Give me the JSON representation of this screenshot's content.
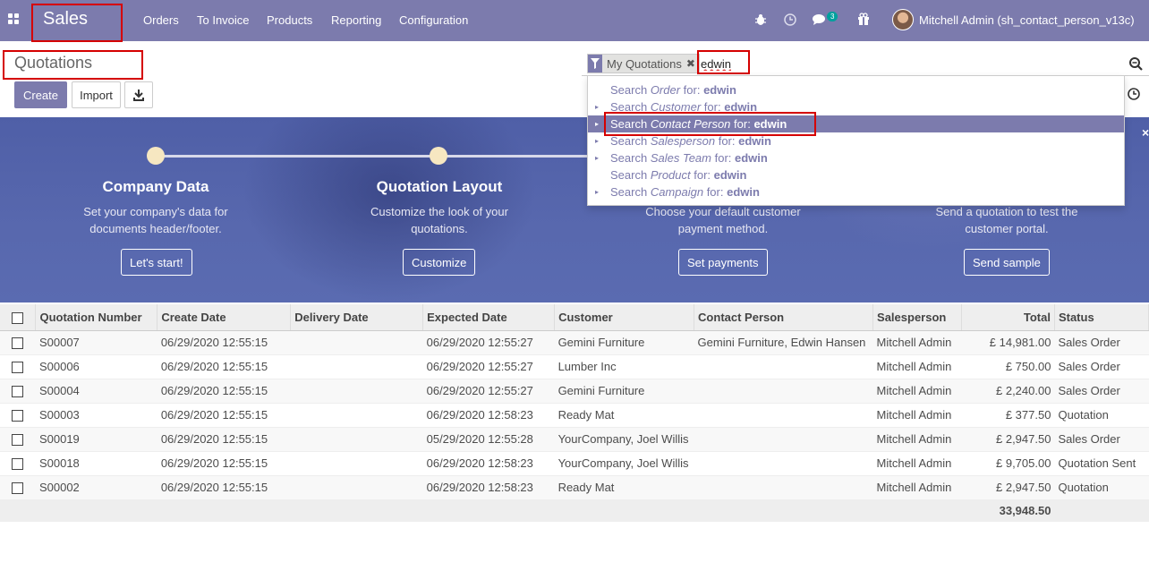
{
  "navbar": {
    "brand": "Sales",
    "menu": [
      "Orders",
      "To Invoice",
      "Products",
      "Reporting",
      "Configuration"
    ],
    "chat_count": "3",
    "user": "Mitchell Admin (sh_contact_person_v13c)"
  },
  "control": {
    "title": "Quotations",
    "create_label": "Create",
    "import_label": "Import"
  },
  "search": {
    "facet_label": "My Quotations",
    "query": "edwin",
    "suggestions": [
      {
        "prefix": "Search ",
        "field": "Order",
        "mid": " for: ",
        "term": "edwin",
        "expandable": false
      },
      {
        "prefix": "Search ",
        "field": "Customer",
        "mid": " for: ",
        "term": "edwin",
        "expandable": true
      },
      {
        "prefix": "Search ",
        "field": "Contact Person",
        "mid": " for: ",
        "term": "edwin",
        "expandable": true
      },
      {
        "prefix": "Search ",
        "field": "Salesperson",
        "mid": " for: ",
        "term": "edwin",
        "expandable": true
      },
      {
        "prefix": "Search ",
        "field": "Sales Team",
        "mid": " for: ",
        "term": "edwin",
        "expandable": true
      },
      {
        "prefix": "Search ",
        "field": "Product",
        "mid": " for: ",
        "term": "edwin",
        "expandable": false
      },
      {
        "prefix": "Search ",
        "field": "Campaign",
        "mid": " for: ",
        "term": "edwin",
        "expandable": true
      }
    ]
  },
  "onboarding": {
    "steps": [
      {
        "title": "Company Data",
        "desc1": "Set your company's data for",
        "desc2": "documents header/footer.",
        "button": "Let's start!"
      },
      {
        "title": "Quotation Layout",
        "desc1": "Customize the look of your",
        "desc2": "quotations.",
        "button": "Customize"
      },
      {
        "title": "",
        "desc1": "Choose your default customer",
        "desc2": "payment method.",
        "button": "Set payments"
      },
      {
        "title": "",
        "desc1": "Send a quotation to test the",
        "desc2": "customer portal.",
        "button": "Send sample"
      }
    ]
  },
  "table": {
    "headers": [
      "Quotation Number",
      "Create Date",
      "Delivery Date",
      "Expected Date",
      "Customer",
      "Contact Person",
      "Salesperson",
      "Total",
      "Status"
    ],
    "rows": [
      [
        "S00007",
        "06/29/2020 12:55:15",
        "",
        "06/29/2020 12:55:27",
        "Gemini Furniture",
        "Gemini Furniture, Edwin Hansen",
        "Mitchell Admin",
        "£ 14,981.00",
        "Sales Order"
      ],
      [
        "S00006",
        "06/29/2020 12:55:15",
        "",
        "06/29/2020 12:55:27",
        "Lumber Inc",
        "",
        "Mitchell Admin",
        "£ 750.00",
        "Sales Order"
      ],
      [
        "S00004",
        "06/29/2020 12:55:15",
        "",
        "06/29/2020 12:55:27",
        "Gemini Furniture",
        "",
        "Mitchell Admin",
        "£ 2,240.00",
        "Sales Order"
      ],
      [
        "S00003",
        "06/29/2020 12:55:15",
        "",
        "06/29/2020 12:58:23",
        "Ready Mat",
        "",
        "Mitchell Admin",
        "£ 377.50",
        "Quotation"
      ],
      [
        "S00019",
        "06/29/2020 12:55:15",
        "",
        "05/29/2020 12:55:28",
        "YourCompany, Joel Willis",
        "",
        "Mitchell Admin",
        "£ 2,947.50",
        "Sales Order"
      ],
      [
        "S00018",
        "06/29/2020 12:55:15",
        "",
        "06/29/2020 12:58:23",
        "YourCompany, Joel Willis",
        "",
        "Mitchell Admin",
        "£ 9,705.00",
        "Quotation Sent"
      ],
      [
        "S00002",
        "06/29/2020 12:55:15",
        "",
        "06/29/2020 12:58:23",
        "Ready Mat",
        "",
        "Mitchell Admin",
        "£ 2,947.50",
        "Quotation"
      ]
    ],
    "total": "33,948.50"
  },
  "colors": {
    "brand": "#7c7bad",
    "highlight": "#d50000"
  }
}
